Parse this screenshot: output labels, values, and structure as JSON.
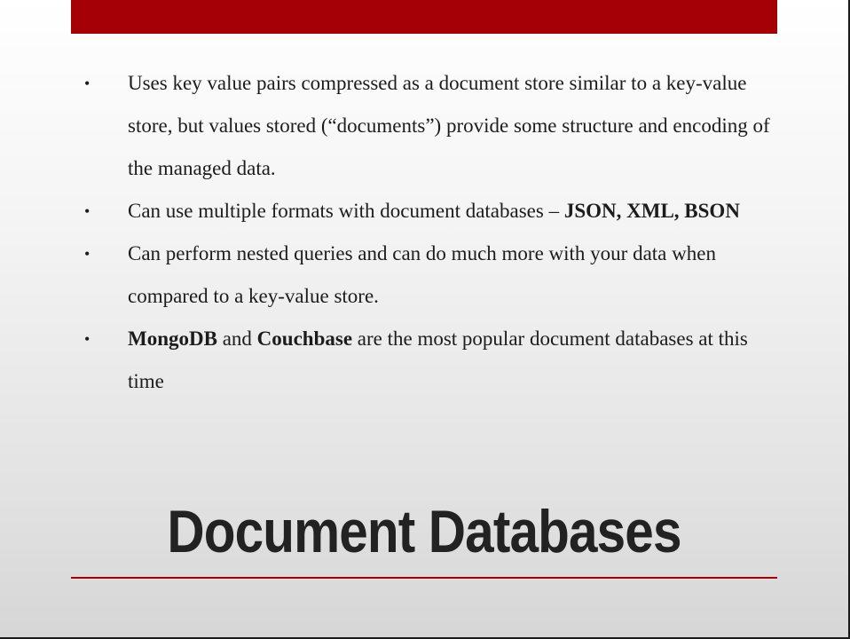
{
  "slide": {
    "title": "Document Databases",
    "bullet_symbol": "•",
    "accent_color": "#a50006",
    "bullets": [
      {
        "text": "Uses key value pairs compressed as a document store similar to a key-value store, but values stored (“documents”) provide some structure and encoding of the managed data."
      },
      {
        "text_before": "Can use multiple formats with document databases – ",
        "bold": "JSON, XML, BSON"
      },
      {
        "text": "Can perform nested queries and can do much more with your data when compared to a key-value store."
      },
      {
        "bold1": "MongoDB",
        "text_mid": " and ",
        "bold2": "Couchbase",
        "text_after": " are the most popular document databases at this time"
      }
    ]
  }
}
